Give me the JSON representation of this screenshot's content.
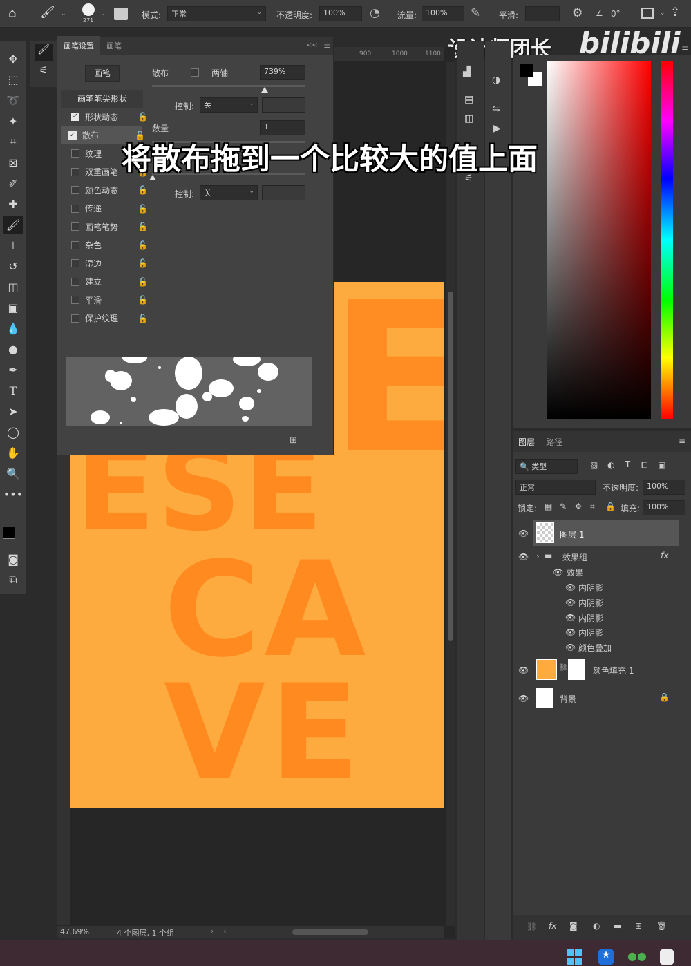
{
  "options_bar": {
    "brush_size": "271",
    "mode_label": "模式:",
    "mode_value": "正常",
    "opacity_label": "不透明度:",
    "opacity_value": "100%",
    "flow_label": "流量:",
    "flow_value": "100%",
    "smooth_label": "平滑:",
    "angle_value": "0°"
  },
  "watermark": {
    "text": "设计师团长",
    "logo": "bilibili"
  },
  "caption": "将散布拖到一个比较大的值上面",
  "ruler_top_ticks": [
    "900",
    "1000",
    "1100"
  ],
  "brush_panel": {
    "tabs": [
      "画笔设置",
      "画笔"
    ],
    "brushes_button": "画笔",
    "tip_shape": "画笔笔尖形状",
    "options": [
      {
        "label": "形状动态",
        "checked": true
      },
      {
        "label": "散布",
        "checked": true
      },
      {
        "label": "纹理",
        "checked": false
      },
      {
        "label": "双重画笔",
        "checked": false
      },
      {
        "label": "颜色动态",
        "checked": false
      },
      {
        "label": "传递",
        "checked": false
      },
      {
        "label": "画笔笔势",
        "checked": false
      },
      {
        "label": "杂色",
        "checked": false
      },
      {
        "label": "湿边",
        "checked": false
      },
      {
        "label": "建立",
        "checked": false
      },
      {
        "label": "平滑",
        "checked": false
      },
      {
        "label": "保护纹理",
        "checked": false
      }
    ],
    "scatter_label": "散布",
    "both_axes_label": "两轴",
    "scatter_value": "739%",
    "control_label": "控制:",
    "control_value": "关",
    "count_label": "数量",
    "count_value": "1",
    "control2_label": "控制:",
    "control2_value": "关"
  },
  "canvas": {
    "rows": [
      "ESE",
      "CA",
      "VE"
    ]
  },
  "status": {
    "zoom": "47.69%",
    "info": "4 个图层, 1 个组"
  },
  "layers_panel": {
    "tabs": [
      "图层",
      "路径"
    ],
    "filter_label": "类型",
    "blend_mode": "正常",
    "opacity_label": "不透明度:",
    "opacity_value": "100%",
    "lock_label": "锁定:",
    "fill_label": "填充:",
    "fill_value": "100%",
    "layers": [
      {
        "name": "图层 1",
        "type": "transparent"
      },
      {
        "name": "效果组",
        "type": "group",
        "fx": "fx"
      },
      {
        "name": "效果",
        "type": "effects-header"
      },
      {
        "name": "内阴影",
        "type": "effect"
      },
      {
        "name": "内阴影",
        "type": "effect"
      },
      {
        "name": "内阴影",
        "type": "effect"
      },
      {
        "name": "内阴影",
        "type": "effect"
      },
      {
        "name": "颜色叠加",
        "type": "effect"
      },
      {
        "name": "颜色填充 1",
        "type": "fill"
      },
      {
        "name": "背景",
        "type": "background"
      }
    ]
  },
  "colors": {
    "artboard": "#fdaa3e",
    "letters": "#ff8a20",
    "foreground": "#000000",
    "background": "#ffffff"
  }
}
